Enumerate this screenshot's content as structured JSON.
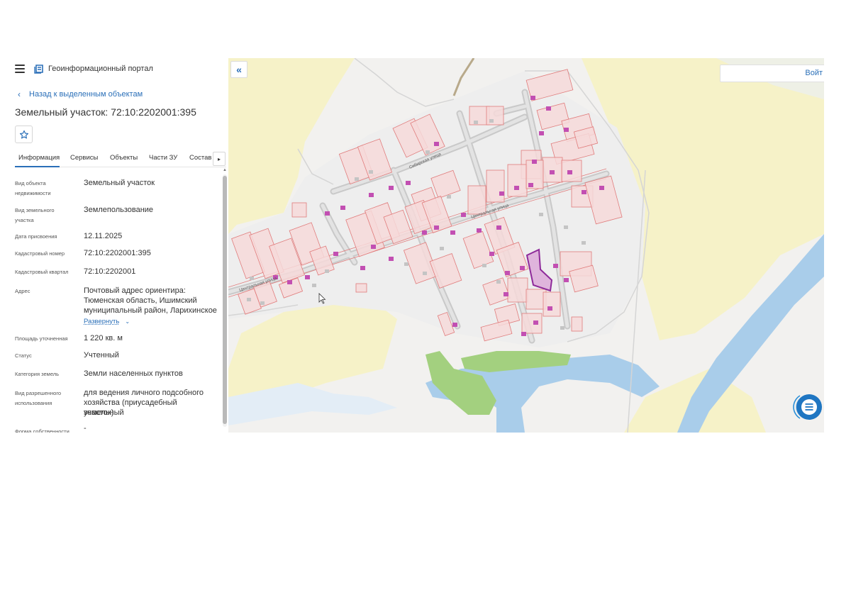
{
  "header": {
    "menu_icon": "hamburger-icon",
    "logo_icon": "portal-logo-icon",
    "portal_title": "Геоинформационный портал"
  },
  "back_link": {
    "icon": "chevron-left-icon",
    "label": "Назад к выделенным объектам"
  },
  "object": {
    "title": "Земельный участок: 72:10:2202001:395",
    "favorite_icon": "star-icon"
  },
  "tabs": [
    {
      "label": "Информация",
      "active": true
    },
    {
      "label": "Сервисы",
      "active": false
    },
    {
      "label": "Объекты",
      "active": false
    },
    {
      "label": "Части ЗУ",
      "active": false
    },
    {
      "label": "Состав",
      "active": false
    }
  ],
  "tab_arrow_icon": "chevron-right-icon",
  "info": {
    "object_type": {
      "label": "Вид объекта недвижимости",
      "value": "Земельный участок"
    },
    "plot_type": {
      "label": "Вид земельного участка",
      "value": "Землепользование"
    },
    "assign_date": {
      "label": "Дата присвоения",
      "value": "12.11.2025"
    },
    "cadastral_number": {
      "label": "Кадастровый номер",
      "value": "72:10:2202001:395"
    },
    "cadastral_block": {
      "label": "Кадастровый квартал",
      "value": "72:10:2202001"
    },
    "address": {
      "label": "Адрес",
      "lines": [
        "Почтовый адрес ориентира:",
        "Тюменская область, Ишимский",
        "муниципальный район, Ларихинское"
      ],
      "expand_label": "Развернуть"
    },
    "area": {
      "label": "Площадь уточненная",
      "value": "1 220 кв. м"
    },
    "status": {
      "label": "Статус",
      "value": "Учтенный"
    },
    "land_category": {
      "label": "Категория земель",
      "value": "Земли населенных пунктов"
    },
    "permitted_use": {
      "label": "Вид разрешенного использования",
      "lines": [
        "для ведения личного подсобного",
        "хозяйства (приусадебный земельный",
        "участок)"
      ]
    },
    "ownership": {
      "label": "Форма собственности",
      "value": "-"
    }
  },
  "map": {
    "collapse_icon": "double-chevron-left-icon",
    "login_label": "Войт",
    "chat_icon": "chat-icon",
    "streets": {
      "siberian": "Сибирская улица",
      "central_a": "Центральная улица",
      "central_b": "Центральная улица"
    },
    "colors": {
      "background": "#f2f1ef",
      "field": "#f6f2c8",
      "water": "#a9cdea",
      "forest": "#a3d07f",
      "parcel_fill": "#f6d9d9",
      "parcel_stroke": "#e07c7c",
      "building": "#c24fb2",
      "selected_parcel": "#8e2a9a",
      "accent": "#2a6fb8"
    }
  }
}
